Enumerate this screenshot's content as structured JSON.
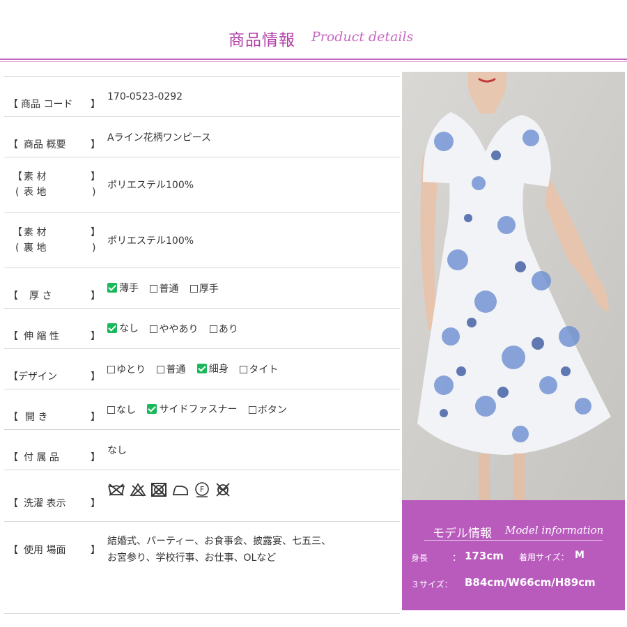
{
  "header": {
    "title_jp": "商品情報",
    "title_en": "Product details"
  },
  "rows": {
    "code": {
      "label": "商品 コード",
      "value": "170-0523-0292"
    },
    "summary": {
      "label": "商品 概要",
      "value": "Aライン花柄ワンピース"
    },
    "material_outer": {
      "label_top": "素 材",
      "label_bottom": "表 地",
      "value": "ポリエステル100%"
    },
    "material_lining": {
      "label_top": "素 材",
      "label_bottom": "裏 地",
      "value": "ポリエステル100%"
    },
    "thickness": {
      "label": "厚 さ",
      "options": [
        {
          "label": "薄手",
          "checked": true
        },
        {
          "label": "普通",
          "checked": false
        },
        {
          "label": "厚手",
          "checked": false
        }
      ]
    },
    "stretch": {
      "label": "伸 縮 性",
      "options": [
        {
          "label": "なし",
          "checked": true
        },
        {
          "label": "ややあり",
          "checked": false
        },
        {
          "label": "あり",
          "checked": false
        }
      ]
    },
    "design": {
      "label": "デザイン",
      "options": [
        {
          "label": "ゆとり",
          "checked": false
        },
        {
          "label": "普通",
          "checked": false
        },
        {
          "label": "細身",
          "checked": true
        },
        {
          "label": "タイト",
          "checked": false
        }
      ]
    },
    "opening": {
      "label": "開 き",
      "options": [
        {
          "label": "なし",
          "checked": false
        },
        {
          "label": "サイドファスナー",
          "checked": true
        },
        {
          "label": "ボタン",
          "checked": false
        }
      ]
    },
    "accessories": {
      "label": "付 属 品",
      "value": "なし"
    },
    "washing": {
      "label": "洗濯 表示",
      "icons": [
        "no-wash-icon",
        "no-bleach-icon",
        "no-tumble-dry-icon",
        "iron-low-icon",
        "dry-clean-f-icon",
        "no-wring-icon"
      ]
    },
    "usage": {
      "label": "使用 場面",
      "value_line1": "結婚式、パーティー、お食事会、披露宴、七五三、",
      "value_line2": "お宮参り、学校行事、お仕事、OLなど"
    }
  },
  "model": {
    "title_jp": "モデル情報",
    "title_en": "Model information",
    "height_label": "身長",
    "height_colon": "：",
    "height_value": "173cm",
    "size_label": "着用サイズ：",
    "size_value": "M",
    "three_size_label": "３サイズ：",
    "three_size_value": "B84cm/W66cm/H89cm"
  },
  "colors": {
    "accent": "#b13fa8",
    "model_bg": "#b95abd",
    "check": "#19b85a"
  }
}
